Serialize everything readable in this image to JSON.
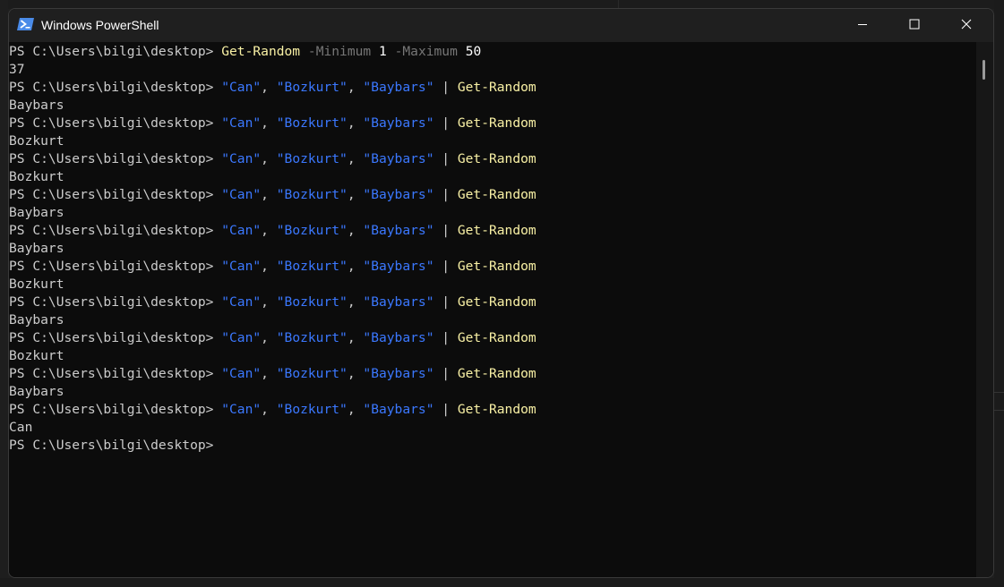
{
  "window": {
    "title": "Windows PowerShell",
    "minimize_label": "",
    "maximize_label": "",
    "close_label": ""
  },
  "colors": {
    "console_bg": "#0c0c0c",
    "command": "#f9f1a5",
    "parameter": "#767676",
    "string": "#3b78ff",
    "text": "#cccccc"
  },
  "console": {
    "prompt": "PS C:\\Users\\bilgi\\desktop> ",
    "first_command": {
      "cmdlet": "Get-Random",
      "param_min": "-Minimum",
      "min_value": "1",
      "param_max": "-Maximum",
      "max_value": "50",
      "output": "37"
    },
    "pipe_command": {
      "str1": "\"Can\"",
      "str2": "\"Bozkurt\"",
      "str3": "\"Baybars\"",
      "sep": ", ",
      "pipe": " | ",
      "cmdlet": "Get-Random"
    },
    "outputs": [
      "Baybars",
      "Bozkurt",
      "Bozkurt",
      "Baybars",
      "Baybars",
      "Bozkurt",
      "Baybars",
      "Bozkurt",
      "Baybars",
      "Can"
    ]
  }
}
